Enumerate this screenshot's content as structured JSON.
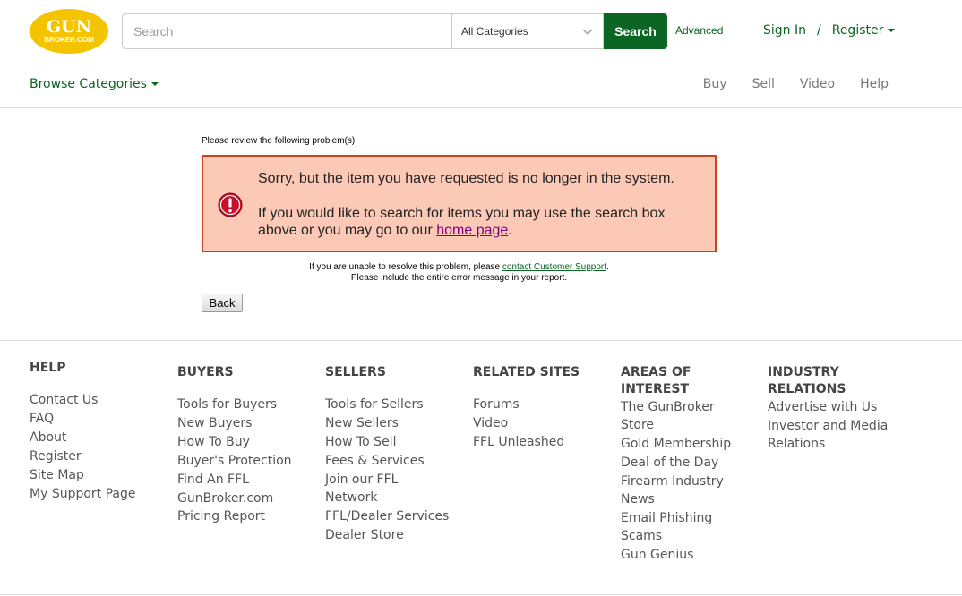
{
  "header": {
    "logo": {
      "line1": "GUN",
      "line2": "BROKER.COM",
      "bg_color": "#f5c400",
      "text_color": "#ffffff"
    },
    "search": {
      "placeholder": "Search",
      "value": "",
      "category": "All Categories",
      "button": "Search",
      "advanced": "Advanced"
    },
    "account": {
      "sign_in": "Sign In",
      "separator": "/",
      "register": "Register"
    },
    "browse": "Browse Categories",
    "nav": [
      {
        "label": "Buy"
      },
      {
        "label": "Sell"
      },
      {
        "label": "Video"
      },
      {
        "label": "Help"
      }
    ]
  },
  "error": {
    "label": "Please review the following problem(s):",
    "message1": "Sorry, but the item you have requested is no longer in the system.",
    "message2_prefix": "If you would like to search for items you may use the search box above or you may go to our ",
    "message2_link": "home page",
    "message2_suffix": ".",
    "support_prefix": "If you are unable to resolve this problem, please ",
    "support_link": "contact Customer Support",
    "support_suffix": ".",
    "support_line2": "Please include the entire error message in your report.",
    "back": "Back",
    "colors": {
      "box_bg": "#fdc9b7",
      "box_border": "#c8441f",
      "icon": "#c8102e"
    }
  },
  "footer": {
    "columns": [
      {
        "title": "HELP",
        "links": [
          "Contact Us",
          "FAQ",
          "About",
          "Register",
          "Site Map",
          "My Support Page"
        ]
      },
      {
        "title": "BUYERS",
        "links": [
          "Tools for Buyers",
          "New Buyers",
          "How To Buy",
          "Buyer's Protection",
          "Find An FFL",
          "GunBroker.com Pricing Report"
        ]
      },
      {
        "title": "SELLERS",
        "links": [
          "Tools for Sellers",
          "New Sellers",
          "How To Sell",
          "Fees & Services",
          "Join our FFL Network",
          "FFL/Dealer Services",
          "Dealer Store"
        ]
      },
      {
        "title": "RELATED SITES",
        "links": [
          "Forums",
          "Video",
          "FFL Unleashed"
        ]
      },
      {
        "title": "AREAS OF INTEREST",
        "links": [
          "The GunBroker Store",
          "Gold Membership",
          "Deal of the Day",
          "Firearm Industry News",
          "Email Phishing Scams",
          "Gun Genius"
        ]
      },
      {
        "title": "INDUSTRY RELATIONS",
        "links": [
          "Advertise with Us",
          "Investor and Media Relations"
        ]
      }
    ]
  }
}
